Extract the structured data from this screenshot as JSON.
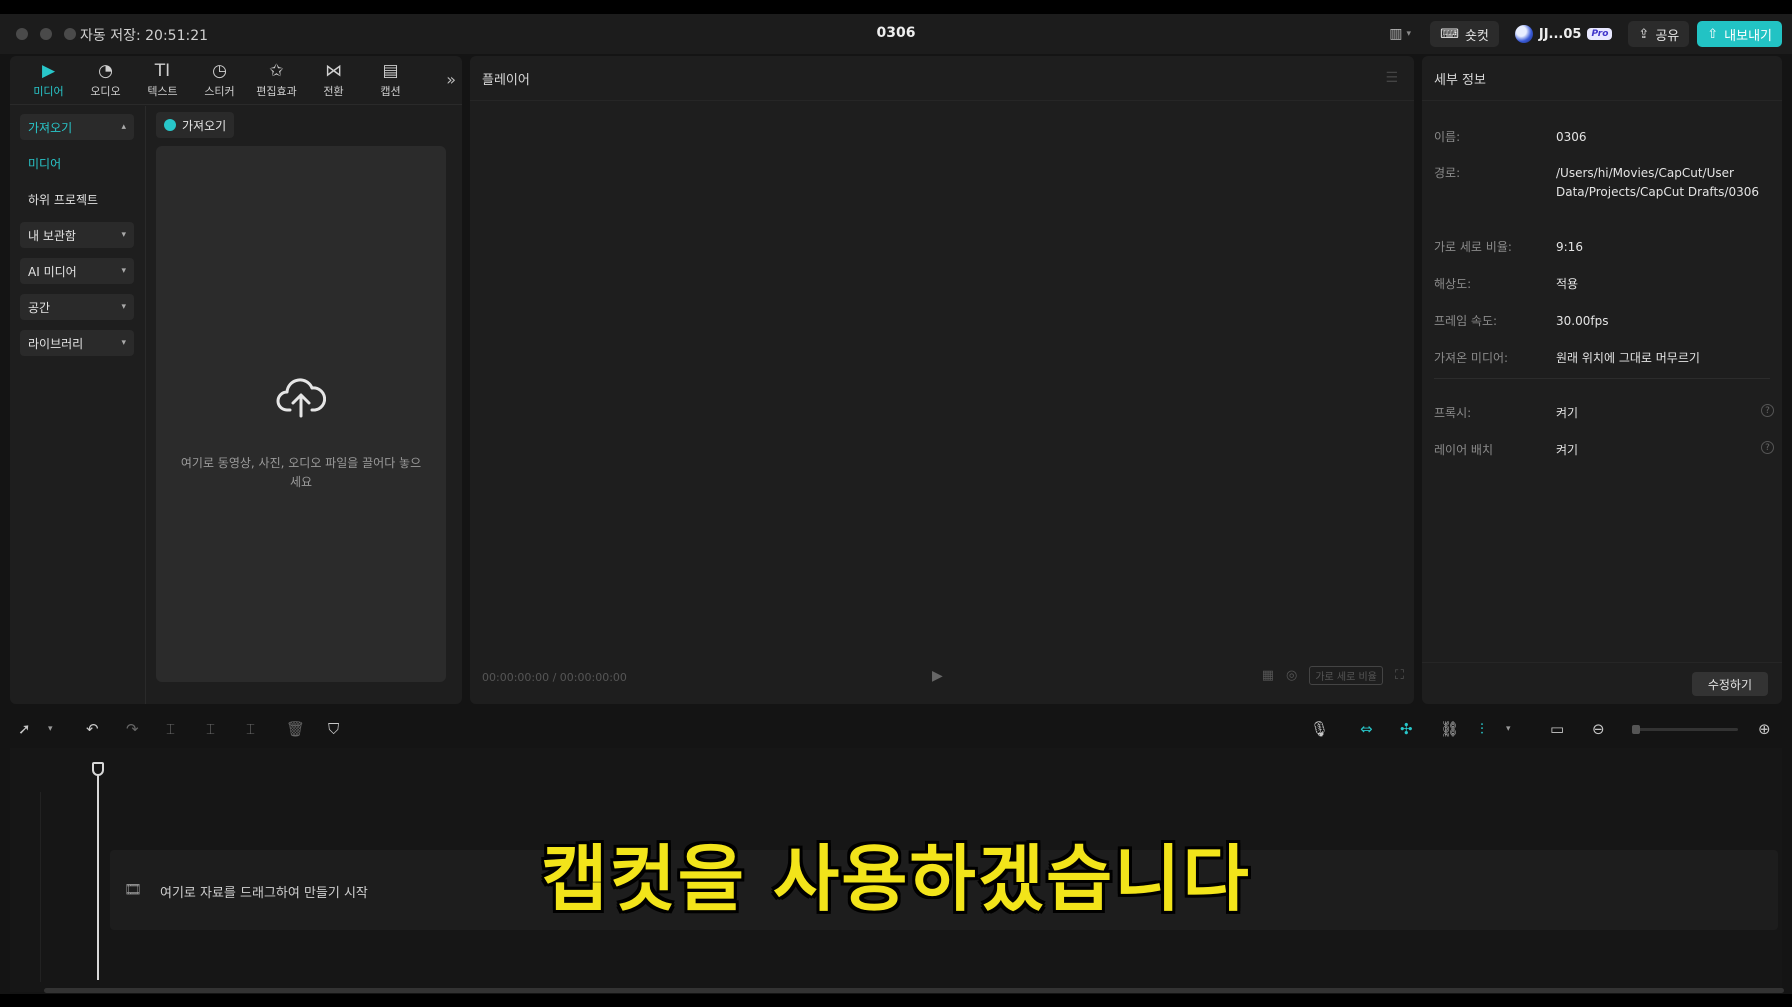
{
  "titlebar": {
    "autosave": "자동 저장: 20:51:21",
    "title": "0306",
    "shortcut_label": "숏컷",
    "user_label": "JJ...05",
    "pro_badge": "Pro",
    "share_label": "공유",
    "export_label": "내보내기"
  },
  "tabs": [
    {
      "label": "미디어",
      "icon": "play-icon"
    },
    {
      "label": "오디오",
      "icon": "audio-icon"
    },
    {
      "label": "텍스트",
      "icon": "text-icon"
    },
    {
      "label": "스티커",
      "icon": "sticker-icon"
    },
    {
      "label": "편집효과",
      "icon": "effects-icon"
    },
    {
      "label": "전환",
      "icon": "transition-icon"
    },
    {
      "label": "캡션",
      "icon": "caption-icon"
    }
  ],
  "sidenav": {
    "import": "가져오기",
    "media": "미디어",
    "subproject": "하위 프로젝트",
    "my_storage": "내 보관함",
    "ai_media": "AI 미디어",
    "space": "공간",
    "library": "라이브러리"
  },
  "import_panel": {
    "chip_label": "가져오기",
    "drop_text": "여기로 동영상, 사진, 오디오 파일을 끌어다 놓으세요"
  },
  "player": {
    "title": "플레이어",
    "time": "00:00:00:00 / 00:00:00:00",
    "ratio_label": "가로 세로 비율"
  },
  "details": {
    "title": "세부 정보",
    "rows": [
      {
        "label": "이름:",
        "value": "0306"
      },
      {
        "label": "경로:",
        "value": "/Users/hi/Movies/CapCut/User Data/Projects/CapCut Drafts/0306"
      },
      {
        "label": "가로 세로 비율:",
        "value": "9:16"
      },
      {
        "label": "해상도:",
        "value": "적용"
      },
      {
        "label": "프레임 속도:",
        "value": "30.00fps"
      },
      {
        "label": "가져온 미디어:",
        "value": "원래 위치에 그대로 머무르기"
      },
      {
        "label": "프록시:",
        "value": "켜기"
      },
      {
        "label": "레이어 배치",
        "value": "켜기"
      }
    ],
    "edit_label": "수정하기"
  },
  "timeline": {
    "drop_hint": "여기로 자료를 드래그하여 만들기 시작"
  },
  "subtitle": "캡컷을 사용하겠습니다",
  "colors": {
    "accent": "#28c6c9",
    "subtitle": "#f2e41a"
  }
}
